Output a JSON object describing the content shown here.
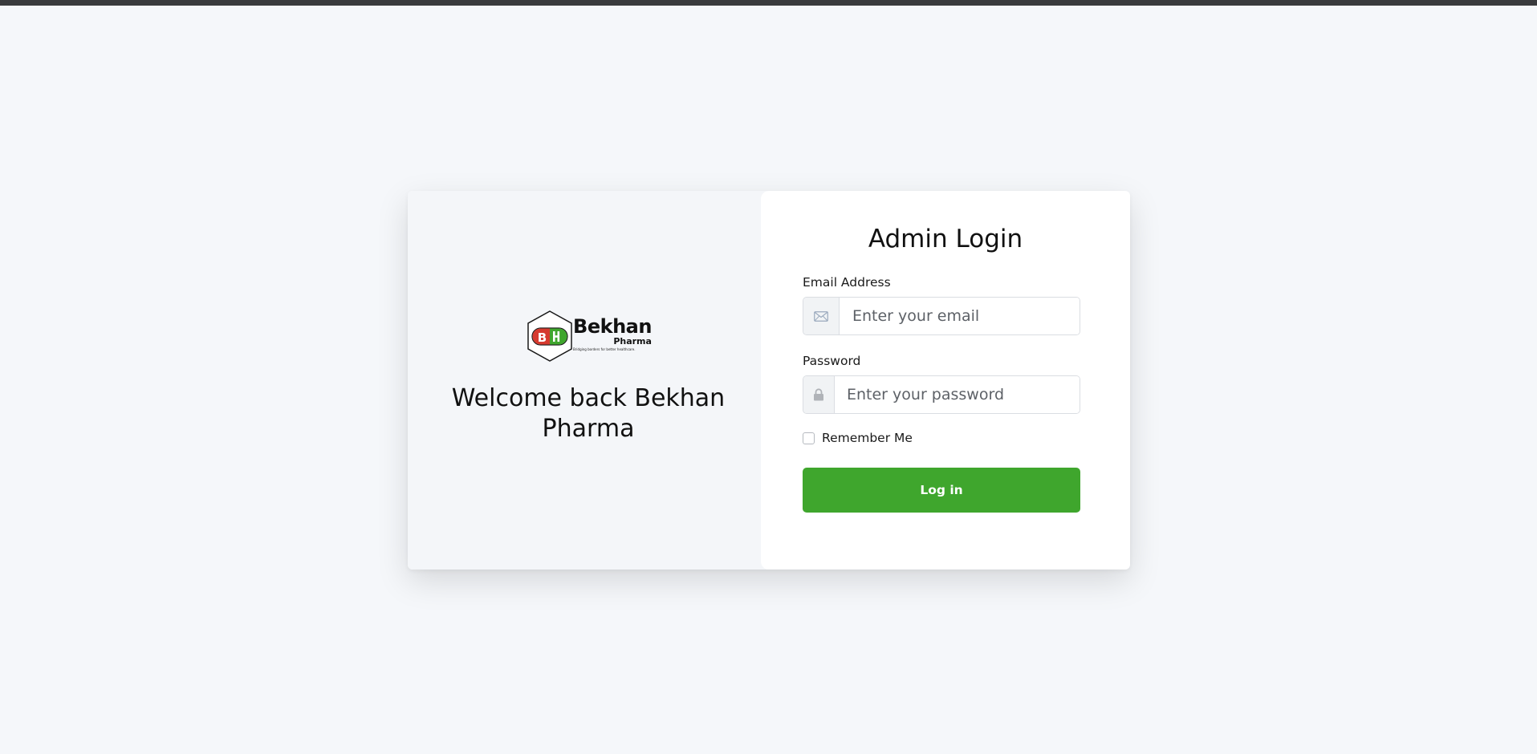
{
  "left": {
    "logo": {
      "brand": "Bekhan",
      "sub": "Pharma",
      "tagline": "Bridging borders for better healthcare."
    },
    "welcome": "Welcome back Bekhan Pharma"
  },
  "form": {
    "title": "Admin Login",
    "email": {
      "label": "Email Address",
      "placeholder": "Enter your email",
      "value": "",
      "icon": "mail-icon"
    },
    "password": {
      "label": "Password",
      "placeholder": "Enter your password",
      "value": "",
      "icon": "lock-icon"
    },
    "remember": {
      "label": "Remember Me",
      "checked": false
    },
    "submit_label": "Log in"
  },
  "colors": {
    "accent": "#3fa62d",
    "page_background": "#f5f7fa",
    "top_bar": "#3a3b3d",
    "logo_red": "#d63a2f",
    "logo_green": "#3fa62d"
  }
}
